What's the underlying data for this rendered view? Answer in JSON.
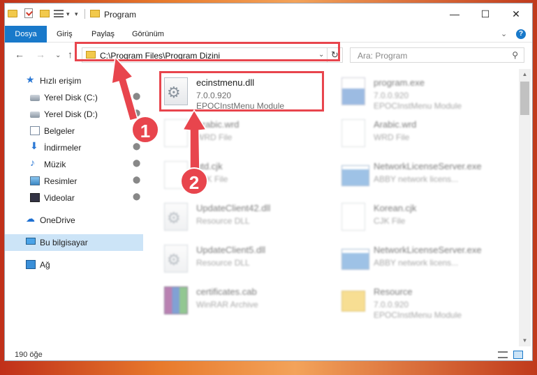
{
  "window": {
    "title": "Program",
    "controls": {
      "minimize": "—",
      "maximize": "☐",
      "close": "✕"
    },
    "qa_dropdown": "▾",
    "qa_separator": "|"
  },
  "ribbon": {
    "tabs": [
      "Dosya",
      "Giriş",
      "Paylaş",
      "Görünüm"
    ],
    "collapse": "⌄",
    "help": "?"
  },
  "nav": {
    "back": "←",
    "forward": "→",
    "recent": "⌄",
    "up": "↑",
    "address": "C:\\Program Files\\Program Dizini",
    "address_dropdown": "⌄",
    "refresh": "↻",
    "search_placeholder": "Ara: Program",
    "search_icon": "search-icon"
  },
  "sidebar": {
    "items": [
      {
        "label": "Hızlı erişim",
        "icon": "star-icon"
      },
      {
        "label": "Yerel Disk (C:)",
        "icon": "disk-icon",
        "pinned": true
      },
      {
        "label": "Yerel Disk (D:)",
        "icon": "disk-icon",
        "pinned": true
      },
      {
        "label": "Belgeler",
        "icon": "documents-icon",
        "pinned": true
      },
      {
        "label": "İndirmeler",
        "icon": "download-icon",
        "pinned": true
      },
      {
        "label": "Müzik",
        "icon": "music-icon",
        "pinned": true
      },
      {
        "label": "Resimler",
        "icon": "pictures-icon",
        "pinned": true
      },
      {
        "label": "Videolar",
        "icon": "videos-icon",
        "pinned": true
      },
      {
        "label": "OneDrive",
        "icon": "cloud-icon"
      },
      {
        "label": "Bu bilgisayar",
        "icon": "computer-icon",
        "selected": true
      },
      {
        "label": "Ağ",
        "icon": "network-icon"
      }
    ],
    "pin_glyph": "📌"
  },
  "files": [
    {
      "name": "ecinstmenu.dll",
      "meta1": "7.0.0.920",
      "meta2": "EPOCInstMenu Module",
      "icon": "dll-icon",
      "highlight": true
    },
    {
      "name": "program.exe",
      "meta1": "7.0.0.920",
      "meta2": "EPOCInstMenu Module",
      "icon": "exe-icon"
    },
    {
      "name": "Arabic.wrd",
      "meta1": "WRD File",
      "meta2": "",
      "icon": "doc-icon"
    },
    {
      "name": "Arabic.wrd",
      "meta1": "WRD File",
      "meta2": "",
      "icon": "doc-icon"
    },
    {
      "name": "gtd.cjk",
      "meta1": "CJK File",
      "meta2": "",
      "icon": "doc-icon"
    },
    {
      "name": "NetworkLicenseServer.exe",
      "meta1": "ABBY network licens...",
      "meta2": "",
      "icon": "exe-icon"
    },
    {
      "name": "UpdateClient42.dll",
      "meta1": "Resource DLL",
      "meta2": "",
      "icon": "dll-icon"
    },
    {
      "name": "Korean.cjk",
      "meta1": "CJK File",
      "meta2": "",
      "icon": "doc-icon"
    },
    {
      "name": "UpdateClient5.dll",
      "meta1": "Resource DLL",
      "meta2": "",
      "icon": "dll-icon"
    },
    {
      "name": "NetworkLicenseServer.exe",
      "meta1": "ABBY network licens...",
      "meta2": "",
      "icon": "exe-icon"
    },
    {
      "name": "certificates.cab",
      "meta1": "WinRAR Archive",
      "meta2": "",
      "icon": "archive-icon"
    },
    {
      "name": "Resource",
      "meta1": "7.0.0.920",
      "meta2": "EPOCInstMenu Module",
      "icon": "folder-icon"
    }
  ],
  "status": {
    "count": "190 öğe"
  },
  "scroll": {
    "up": "▲",
    "down": "▼"
  },
  "annotations": {
    "step1": "1",
    "step2": "2",
    "color": "#e8454d"
  },
  "colors": {
    "accent": "#1979ca",
    "highlight": "#e8454d",
    "selected": "#cce4f7"
  }
}
